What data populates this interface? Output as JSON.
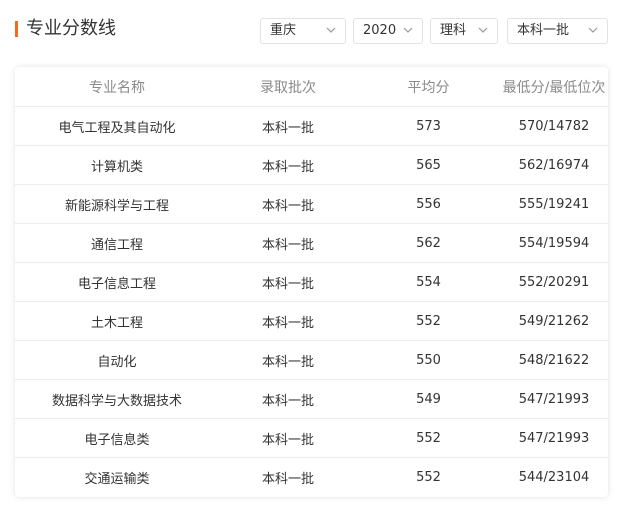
{
  "header": {
    "title": "专业分数线"
  },
  "filters": {
    "province": "重庆",
    "year": "2020",
    "subject": "理科",
    "batch": "本科一批"
  },
  "table": {
    "columns": [
      "专业名称",
      "录取批次",
      "平均分",
      "最低分/最低位次"
    ],
    "rows": [
      [
        "电气工程及其自动化",
        "本科一批",
        "573",
        "570/14782"
      ],
      [
        "计算机类",
        "本科一批",
        "565",
        "562/16974"
      ],
      [
        "新能源科学与工程",
        "本科一批",
        "556",
        "555/19241"
      ],
      [
        "通信工程",
        "本科一批",
        "562",
        "554/19594"
      ],
      [
        "电子信息工程",
        "本科一批",
        "554",
        "552/20291"
      ],
      [
        "土木工程",
        "本科一批",
        "552",
        "549/21262"
      ],
      [
        "自动化",
        "本科一批",
        "550",
        "548/21622"
      ],
      [
        "数据科学与大数据技术",
        "本科一批",
        "549",
        "547/21993"
      ],
      [
        "电子信息类",
        "本科一批",
        "552",
        "547/21993"
      ],
      [
        "交通运输类",
        "本科一批",
        "552",
        "544/23104"
      ]
    ]
  },
  "colors": {
    "accent": "#f26a1b",
    "border": "#e2e2e2",
    "header_text": "#8a8a8a",
    "text": "#333333"
  },
  "icons": {
    "dropdown": "chevron-down-icon",
    "title_marker": "accent-bar"
  }
}
